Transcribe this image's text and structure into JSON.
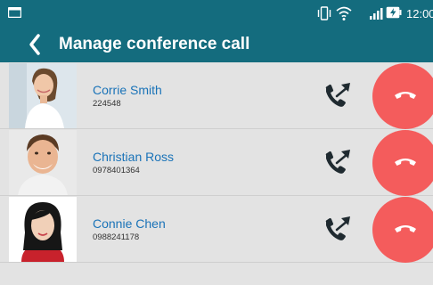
{
  "status_bar": {
    "time": "12:00",
    "icons": [
      "notification-icon",
      "vibrate-icon",
      "wifi-icon",
      "signal-icon",
      "battery-charging-icon"
    ]
  },
  "header": {
    "title": "Manage conference call",
    "back_icon": "chevron-left-icon"
  },
  "participants": [
    {
      "name": "Corrie Smith",
      "number": "224548"
    },
    {
      "name": "Christian Ross",
      "number": "0978401364"
    },
    {
      "name": "Connie Chen",
      "number": "0988241178"
    }
  ],
  "actions": {
    "separate_icon": "private-call-icon",
    "end_icon": "end-call-icon"
  },
  "colors": {
    "header": "#146c7e",
    "name": "#1a73b8",
    "end_button": "#f45c5c",
    "row_background": "#e3e3e3"
  }
}
